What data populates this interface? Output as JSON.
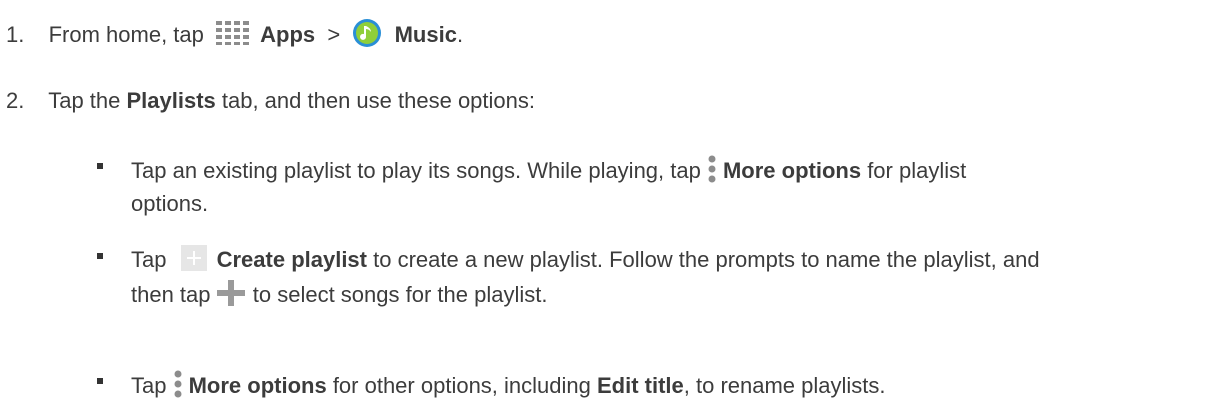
{
  "steps": [
    {
      "number": "1.",
      "t1": "From home, tap",
      "apps_label": "Apps",
      "sep": " > ",
      "music_label": "Music",
      "end": "."
    },
    {
      "number": "2.",
      "t1": "Tap the ",
      "playlists_label": "Playlists",
      "t2": " tab, and then use these options:"
    }
  ],
  "bullets": [
    {
      "t1": "Tap an existing playlist to play its songs. While playing, tap ",
      "more_label": "More options",
      "t2": " for playlist",
      "t3": "options."
    },
    {
      "t1": "Tap ",
      "create_label": "Create playlist",
      "t2": " to create a new playlist. Follow the prompts to name the playlist, and",
      "t3": "then tap ",
      "t4": " to select songs for the playlist."
    },
    {
      "t1": "Tap ",
      "more_label": "More options",
      "t2": " for other options, including ",
      "edit_label": "Edit title",
      "t3": ", to rename playlists."
    }
  ],
  "icons": {
    "apps": "apps-grid-icon",
    "music": "music-note-icon",
    "more": "more-options-icon",
    "create": "create-playlist-icon",
    "add": "add-icon"
  },
  "colors": {
    "text": "#3c3c3c",
    "music_icon_green": "#8fcf3a",
    "music_icon_blue": "#2a8fd6",
    "icon_gray": "#8c8c8c"
  }
}
